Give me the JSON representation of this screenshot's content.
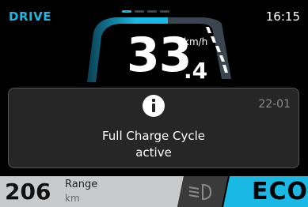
{
  "header": {
    "mode": "DRIVE",
    "time": "16:15",
    "page_indicator": {
      "total": 4,
      "active": 1
    }
  },
  "speedometer": {
    "speed_integer": "33",
    "speed_decimal": ".4",
    "unit": "km/h"
  },
  "message": {
    "icon": "info-icon",
    "code": "22-01",
    "line1": "Full Charge Cycle",
    "line2": "active"
  },
  "footer": {
    "range_value": "206",
    "range_label": "Range",
    "range_unit": "km",
    "headlight_icon": "low-beam-headlight-icon",
    "ride_mode": "ECO"
  },
  "colors": {
    "accent": "#1ab8e4",
    "dialog_bg": "#262626",
    "range_bg": "#c8cacc"
  }
}
